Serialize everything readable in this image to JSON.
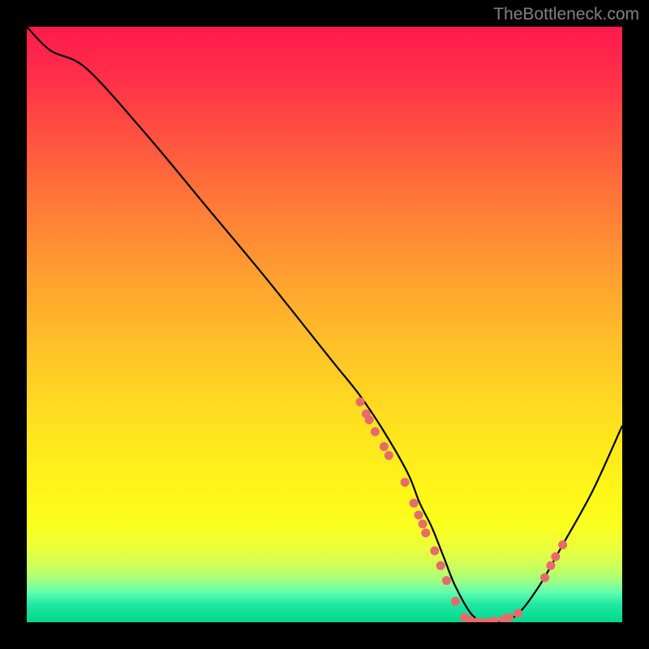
{
  "watermark": "TheBottleneck.com",
  "chart_data": {
    "type": "line",
    "title": "",
    "xlabel": "",
    "ylabel": "",
    "xlim": [
      0,
      100
    ],
    "ylim": [
      0,
      100
    ],
    "curve": {
      "x": [
        0,
        4,
        10,
        20,
        30,
        40,
        48,
        52,
        56,
        60,
        64,
        66,
        68,
        70,
        72,
        75,
        78,
        82,
        86,
        90,
        95,
        100
      ],
      "y": [
        100,
        96,
        93,
        82,
        70,
        58,
        48,
        43,
        38,
        32,
        25,
        20,
        16,
        11,
        6,
        1,
        0,
        1,
        6,
        13,
        22,
        33
      ]
    },
    "markers": [
      {
        "x": 56.0,
        "y": 37.0
      },
      {
        "x": 57.0,
        "y": 35.0
      },
      {
        "x": 57.5,
        "y": 34.0
      },
      {
        "x": 58.5,
        "y": 32.0
      },
      {
        "x": 60.0,
        "y": 29.5
      },
      {
        "x": 60.8,
        "y": 28.0
      },
      {
        "x": 63.5,
        "y": 23.5
      },
      {
        "x": 65.0,
        "y": 20.0
      },
      {
        "x": 65.8,
        "y": 18.0
      },
      {
        "x": 66.5,
        "y": 16.5
      },
      {
        "x": 67.0,
        "y": 15.0
      },
      {
        "x": 68.5,
        "y": 12.0
      },
      {
        "x": 69.5,
        "y": 9.5
      },
      {
        "x": 70.5,
        "y": 7.0
      },
      {
        "x": 72.0,
        "y": 3.5
      },
      {
        "x": 73.5,
        "y": 0.8
      },
      {
        "x": 74.5,
        "y": 0.3
      },
      {
        "x": 75.5,
        "y": 0.0
      },
      {
        "x": 76.5,
        "y": 0.0
      },
      {
        "x": 77.5,
        "y": 0.0
      },
      {
        "x": 78.5,
        "y": 0.2
      },
      {
        "x": 80.0,
        "y": 0.5
      },
      {
        "x": 81.0,
        "y": 0.8
      },
      {
        "x": 82.5,
        "y": 1.5
      },
      {
        "x": 87.0,
        "y": 7.5
      },
      {
        "x": 88.0,
        "y": 9.5
      },
      {
        "x": 88.8,
        "y": 11.0
      },
      {
        "x": 90.0,
        "y": 13.0
      }
    ],
    "gradient_colors": {
      "top": "#ff1a4d",
      "mid": "#ffe020",
      "bottom": "#00d890"
    },
    "marker_color": "#e76b6b",
    "curve_color": "#000000"
  }
}
